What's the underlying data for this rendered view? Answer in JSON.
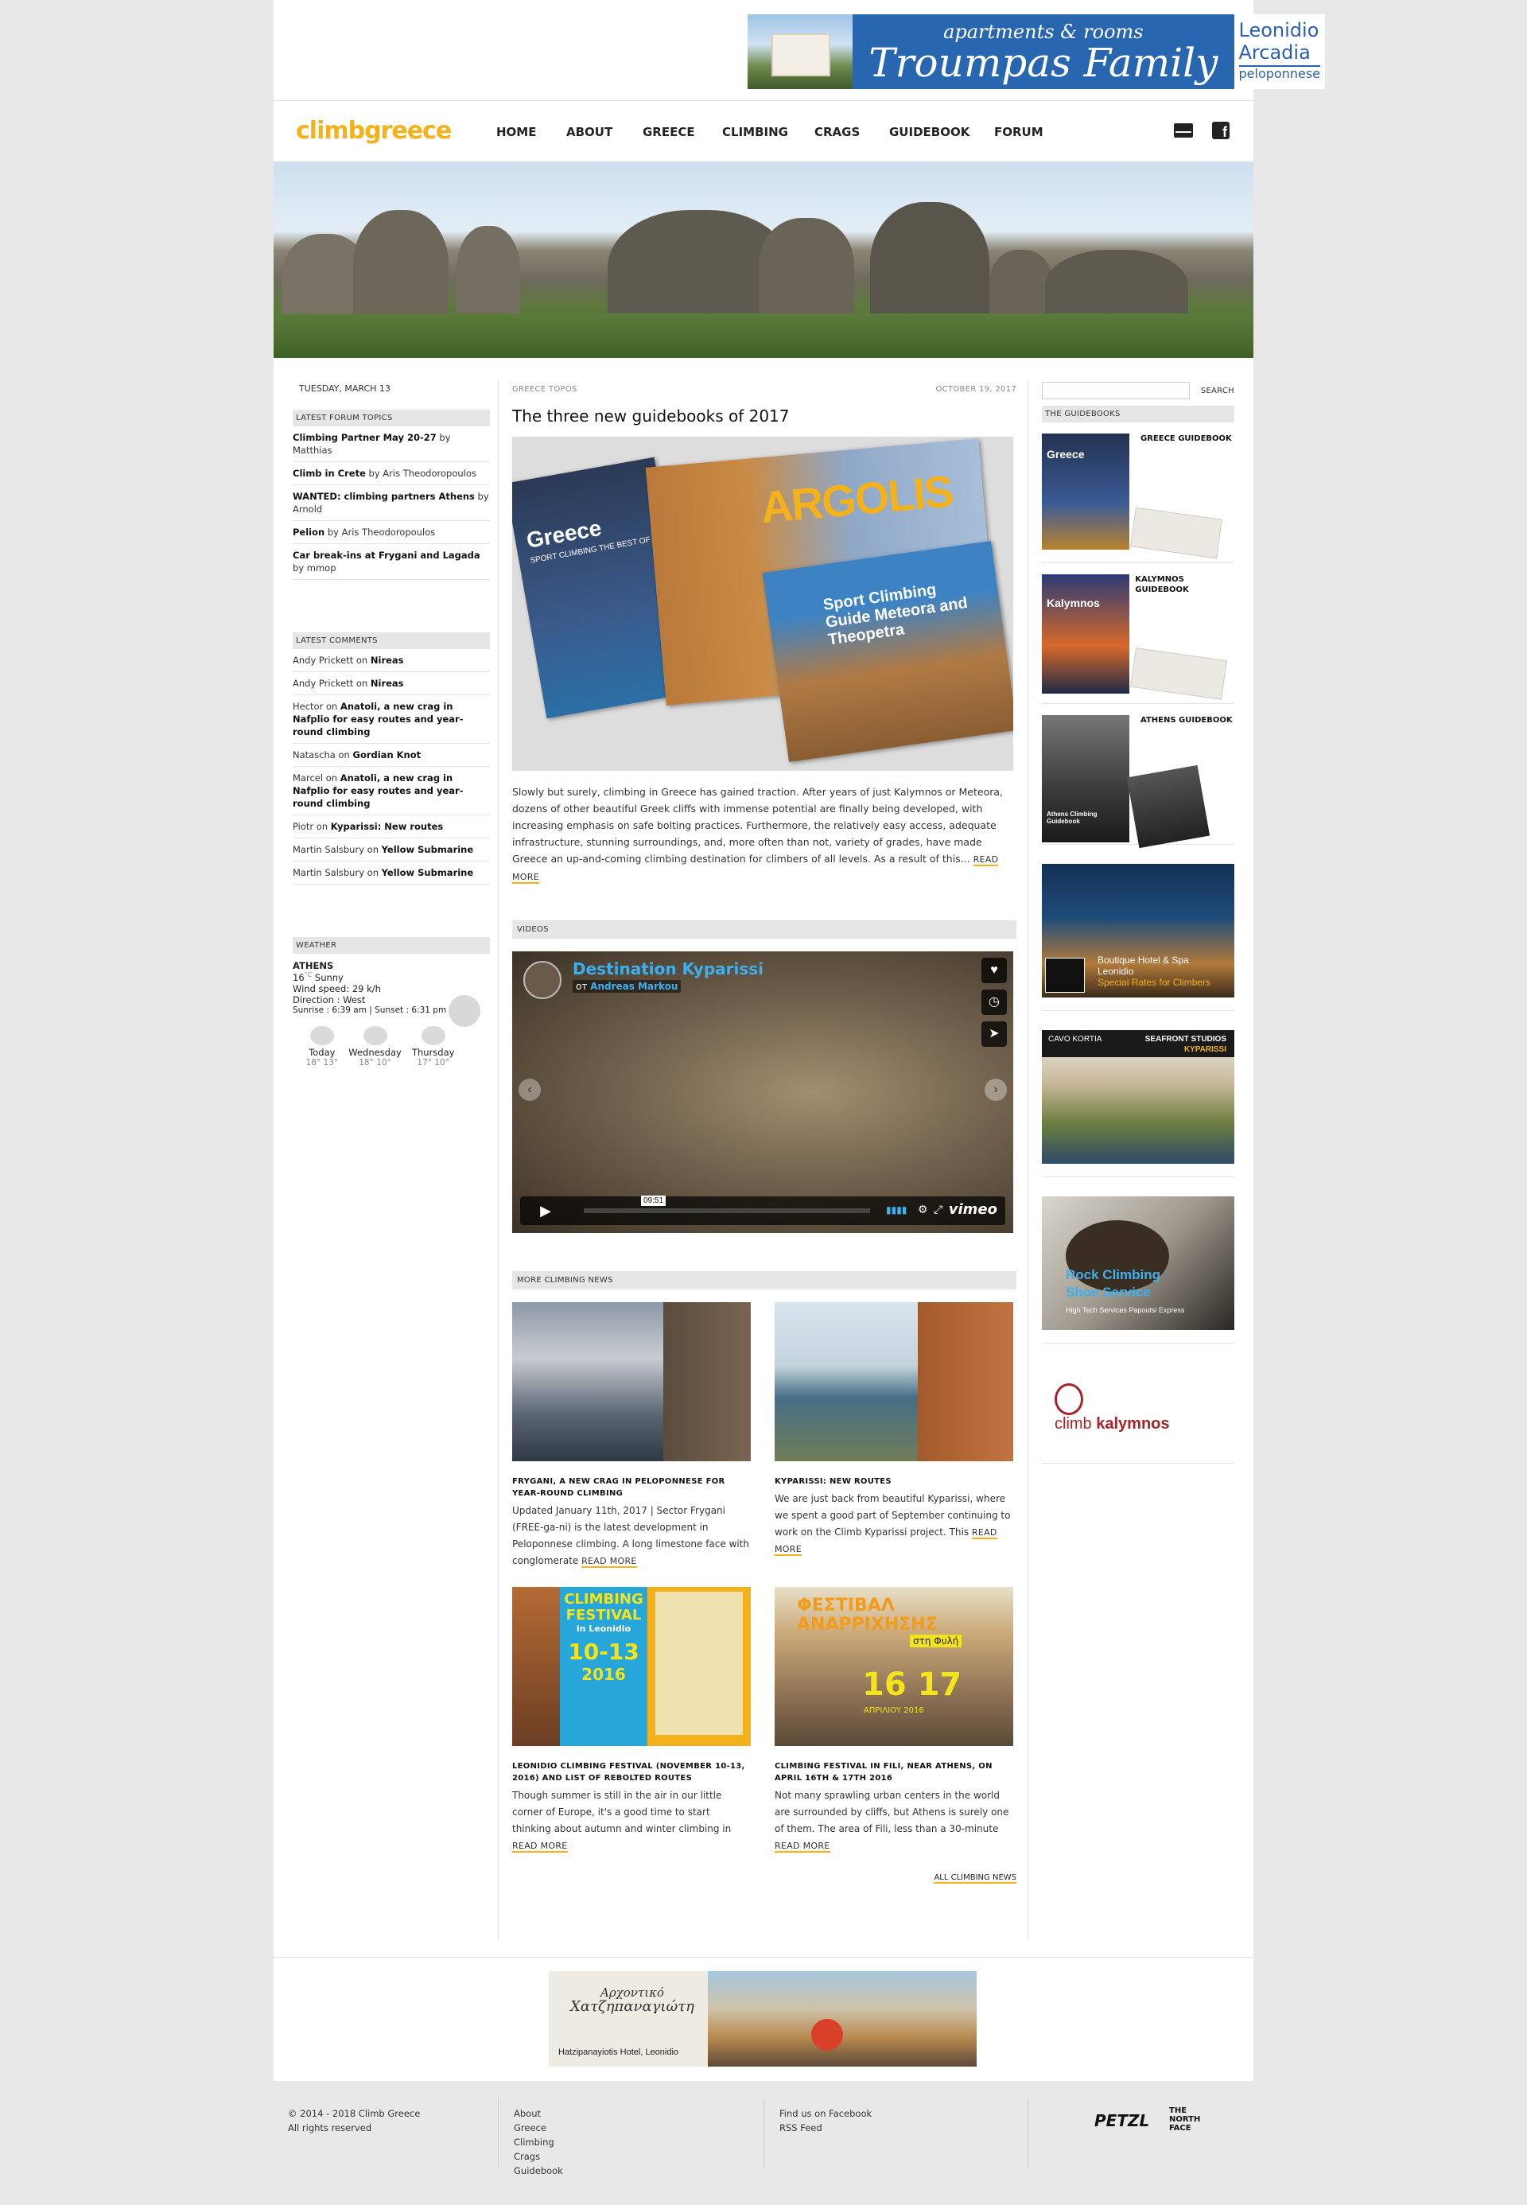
{
  "top_ad": {
    "line1": "apartments & rooms",
    "line2": "Troumpas Family",
    "loc1": "Leonidio",
    "loc2": "Arcadia",
    "loc3": "peloponnese"
  },
  "logo": "climbgreece",
  "nav": [
    "HOME",
    "ABOUT",
    "GREECE",
    "CLIMBING",
    "CRAGS",
    "GUIDEBOOK",
    "FORUM"
  ],
  "left": {
    "date": "TUESDAY, MARCH 13",
    "forum_title": "LATEST FORUM TOPICS",
    "forum": [
      {
        "topic": "Climbing Partner May 20-27",
        "by": " by Matthias"
      },
      {
        "topic": "Climb in Crete",
        "by": " by Aris Theodoropoulos"
      },
      {
        "topic": "WANTED: climbing partners Athens",
        "by": " by Arnold"
      },
      {
        "topic": "Pelion",
        "by": " by Aris Theodoropoulos"
      },
      {
        "topic": "Car break-ins at Frygani and Lagada",
        "by": " by mmop"
      }
    ],
    "comments_title": "LATEST COMMENTS",
    "comments": [
      {
        "who": "Andy Prickett on ",
        "what": "Nireas"
      },
      {
        "who": "Andy Prickett on ",
        "what": "Nireas"
      },
      {
        "who": "Hector on ",
        "what": "Anatoli, a new crag in Nafplio for easy routes and year-round climbing"
      },
      {
        "who": "Natascha on ",
        "what": "Gordian Knot"
      },
      {
        "who": "Marcel on ",
        "what": "Anatoli, a new crag in Nafplio for easy routes and year-round climbing"
      },
      {
        "who": "Piotr on ",
        "what": "Kyparissi: New routes"
      },
      {
        "who": "Martin Salsbury on ",
        "what": "Yellow Submarine"
      },
      {
        "who": "Martin Salsbury on ",
        "what": "Yellow Submarine"
      }
    ],
    "weather_title": "WEATHER",
    "weather": {
      "city": "ATHENS",
      "temp": "16",
      "unit": "°C",
      "cond": "Sunny",
      "wind": "Wind speed: 29 k/h",
      "direction": "Direction : West",
      "sun": "Sunrise : 6:39 am | Sunset : 6:31 pm",
      "forecast": [
        {
          "day": "Today",
          "hi": "18",
          "lo": "13"
        },
        {
          "day": "Wednesday",
          "hi": "18",
          "lo": "10"
        },
        {
          "day": "Thursday",
          "hi": "17",
          "lo": "10"
        }
      ]
    }
  },
  "main": {
    "category": "GREECE TOPOS",
    "date": "OCTOBER 19, 2017",
    "title": "The three new guidebooks of 2017",
    "book1_title": "Greece",
    "book1_sub": "SPORT CLIMBING THE BEST OF",
    "book2_title": "ARGOLIS",
    "book3_title": "Sport Climbing Guide Meteora and Theopetra",
    "excerpt": "Slowly but surely, climbing in Greece has gained traction. After years of just Kalymnos or Meteora, dozens of other beautiful Greek cliffs with immense potential are finally being developed, with increasing emphasis on safe bolting practices. Furthermore, the relatively easy access, adequate infrastructure, stunning surroundings, and, more often than not, variety of grades, have made Greece an up-and-coming climbing destination for climbers of all levels. As a result of this... ",
    "read_more": "READ MORE",
    "videos_title": "VIDEOS",
    "video": {
      "title": "Destination Kyparissi",
      "by_prefix": "от ",
      "by": "Andreas Markou",
      "time": "09:51",
      "brand": "vimeo"
    },
    "news_title": "MORE CLIMBING NEWS",
    "news": [
      {
        "title": "FRYGANI, A NEW CRAG IN PELOPONNESE FOR YEAR-ROUND CLIMBING",
        "text": "Updated January 11th, 2017 | Sector Frygani (FREE-ga-ni) is the latest development in Peloponnese climbing. A long limestone face with conglomerate ",
        "more": "READ MORE"
      },
      {
        "title": "KYPARISSI: NEW ROUTES",
        "text": "We are just back from beautiful Kyparissi, where we spent a good part of September continuing to work on the Climb Kyparissi project. This ",
        "more": "READ MORE"
      },
      {
        "title": "LEONIDIO CLIMBING FESTIVAL (NOVEMBER 10-13, 2016) AND LIST OF REBOLTED ROUTES",
        "text": "Though summer is still in the air in our little corner of Europe, it's a good time to start thinking about autumn and winter climbing in ",
        "more": "READ MORE",
        "poster_a": "CLIMBING FESTIVAL",
        "poster_b": "in Leonidio",
        "poster_c": "10-13",
        "poster_d": "2016"
      },
      {
        "title": "CLIMBING FESTIVAL IN FILI, NEAR ATHENS, ON APRIL 16TH & 17TH 2016",
        "text": "Not many sprawling urban centers in the world are surrounded by cliffs, but Athens is surely one of them. The area of Fili, less than a 30-minute ",
        "more": "READ MORE",
        "poster_a": "ΦΕΣΤΙΒΑΛ ΑΝΑΡΡΙΧΗΣΗΣ",
        "poster_b": "στη Φυλή",
        "poster_c": "16 17",
        "poster_d": "ΑΠΡΙΛΙΟΥ 2016"
      }
    ],
    "all_news": "ALL CLIMBING NEWS"
  },
  "right": {
    "search_btn": "SEARCH",
    "guides_title": "THE GUIDEBOOKS",
    "guides": [
      {
        "label": "GREECE GUIDEBOOK",
        "cover": "Greece"
      },
      {
        "label": "KALYMNOS GUIDEBOOK",
        "cover": "Kalymnos"
      },
      {
        "label": "ATHENS GUIDEBOOK",
        "cover": "Athens Climbing Guidebook"
      }
    ],
    "sponsor1": {
      "a": "Boutique Hotel & Spa",
      "b": "Leonidio",
      "c": "Special Rates for Climbers"
    },
    "sponsor2": {
      "a": "CAVO KORTIA",
      "b": "SEAFRONT STUDIOS",
      "c": "KYPARISSI"
    },
    "sponsor3": {
      "a": "Rock Climbing",
      "b": "Shoe Service",
      "c": "High Tech Services Papoutsi Express"
    },
    "sponsor4": {
      "a": "climb",
      "b": "kalymnos"
    }
  },
  "bottom_ad": {
    "a": "Αρχοντικό",
    "b": "Χατζηπαναγιώτη",
    "c": "Hatzipanayiotis Hotel, Leonidio"
  },
  "footer": {
    "copy": "© 2014 - 2018 Climb Greece",
    "rights": "All rights reserved",
    "links1": [
      "About",
      "Greece",
      "Climbing",
      "Crags",
      "Guidebook"
    ],
    "links2": [
      "Find us on Facebook",
      "RSS Feed"
    ],
    "brand1": "PETZL",
    "brand2": "THE NORTH FACE"
  },
  "colors": {
    "accent": "#f3b11b",
    "vimeo_blue": "#3fb0ef",
    "ad_blue": "#2866b0"
  }
}
